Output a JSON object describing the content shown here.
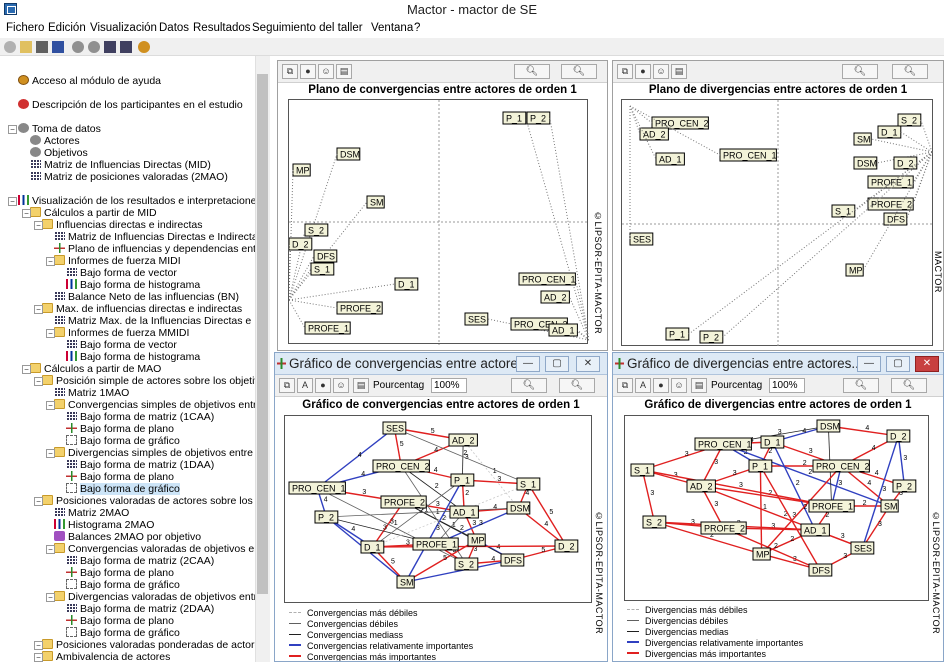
{
  "window": {
    "title": "Mactor  -  mactor de SE"
  },
  "menu": [
    "Fichero",
    "Edición",
    "Visualización",
    "Datos",
    "Resultados",
    "Seguimiento del taller",
    "Ventana",
    "?"
  ],
  "toolbar": {
    "icons": [
      "gear-icon",
      "open-icon",
      "print-icon",
      "save-icon",
      "eye-icon",
      "eye-icon",
      "grid-icon",
      "grid-icon",
      "help-icon"
    ]
  },
  "tree": {
    "items": [
      {
        "label": "Acceso al módulo de ayuda",
        "icon": "help-icon"
      },
      {
        "label": "Descripción de los participantes en el estudio",
        "icon": "people-icon"
      },
      {
        "label": "Toma de datos",
        "icon": "gear-icon"
      },
      {
        "label": "Actores",
        "icon": "gear-icon"
      },
      {
        "label": "Objetivos",
        "icon": "gear-icon"
      },
      {
        "label": "Matriz de Influencias Directas (MID)",
        "icon": "grid-icon"
      },
      {
        "label": "Matriz de posiciones valoradas (2MAO)",
        "icon": "grid-icon"
      },
      {
        "label": "Visualización de los resultados e interpretaciones",
        "icon": "chart-icon"
      },
      {
        "label": "Cálculos a partir de MID",
        "icon": "folder-icon"
      },
      {
        "label": "Influencias directas e indirectas",
        "icon": "folder-icon"
      },
      {
        "label": "Matriz de Influencias Directas e Indirectas (MI",
        "icon": "grid-icon"
      },
      {
        "label": "Plano de influencias y dependencias entre ac",
        "icon": "plane-icon"
      },
      {
        "label": "Informes de fuerza MIDI",
        "icon": "folder-icon"
      },
      {
        "label": "Bajo forma de vector",
        "icon": "grid-icon"
      },
      {
        "label": "Bajo forma de histograma",
        "icon": "histogram-icon"
      },
      {
        "label": "Balance Neto de las influencias (BN)",
        "icon": "grid-icon"
      },
      {
        "label": "Max. de influencias directas e indirectas",
        "icon": "folder-icon"
      },
      {
        "label": "Matriz Max. de la Influencias Directas e Indire",
        "icon": "grid-icon"
      },
      {
        "label": "Informes de fuerza MMIDI",
        "icon": "folder-icon"
      },
      {
        "label": "Bajo forma de vector",
        "icon": "grid-icon"
      },
      {
        "label": "Bajo forma de histograma",
        "icon": "histogram-icon"
      },
      {
        "label": "Cálculos a partir de MAO",
        "icon": "folder-icon"
      },
      {
        "label": "Posición simple de actores sobre los objetivos (",
        "icon": "folder-icon"
      },
      {
        "label": "Matriz 1MAO",
        "icon": "grid-icon"
      },
      {
        "label": "Convergencias simples de objetivos entre ac",
        "icon": "folder-icon"
      },
      {
        "label": "Bajo forma de matriz (1CAA)",
        "icon": "grid-icon"
      },
      {
        "label": "Bajo forma de plano",
        "icon": "plane-icon"
      },
      {
        "label": "Bajo forma de gráfico",
        "icon": "graph-icon"
      },
      {
        "label": "Divergencias simples de objetivos entre acto",
        "icon": "folder-icon"
      },
      {
        "label": "Bajo forma de matriz (1DAA)",
        "icon": "grid-icon"
      },
      {
        "label": "Bajo forma de plano",
        "icon": "plane-icon"
      },
      {
        "label": "Bajo forma de gráfico",
        "icon": "graph-icon"
      },
      {
        "label": "Posiciones valoradas de actores sobre los objet",
        "icon": "folder-icon"
      },
      {
        "label": "Matriz 2MAO",
        "icon": "grid-icon"
      },
      {
        "label": "Histograma 2MAO",
        "icon": "histogram-icon"
      },
      {
        "label": "Balances 2MAO por objetivo",
        "icon": "balance-icon"
      },
      {
        "label": "Convergencias valoradas de objetivos entre",
        "icon": "folder-icon"
      },
      {
        "label": "Bajo forma de matriz (2CAA)",
        "icon": "grid-icon"
      },
      {
        "label": "Bajo forma de plano",
        "icon": "plane-icon"
      },
      {
        "label": "Bajo forma de gráfico",
        "icon": "graph-icon"
      },
      {
        "label": "Divergencias valoradas de objetivos entre a",
        "icon": "folder-icon"
      },
      {
        "label": "Bajo forma de matriz (2DAA)",
        "icon": "grid-icon"
      },
      {
        "label": "Bajo forma de plano",
        "icon": "plane-icon"
      },
      {
        "label": "Bajo forma de gráfico",
        "icon": "graph-icon"
      },
      {
        "label": "Posiciones valoradas ponderadas de actores sc",
        "icon": "folder-icon"
      },
      {
        "label": "Ambivalencia de actores",
        "icon": "folder-icon"
      }
    ]
  },
  "panes": {
    "conv_plane": {
      "title": "Plano de convergencias entre actores de orden 1",
      "caption": "©LIPSOR-EPITA-MACTOR"
    },
    "div_plane": {
      "title": "Plano de divergencias entre actores de orden 1",
      "caption": "©LIPSOR-EPITA-MACTOR"
    },
    "conv_graph": {
      "window_title": "Gráfico de convergencias entre actores...",
      "title": "Gráfico de convergencias entre actores de orden 1",
      "caption": "©LIPSOR-EPITA-MACTOR",
      "pct_label": "Pourcentag",
      "zoom": "100%"
    },
    "div_graph": {
      "window_title": "Gráfico de divergencias entre actores...",
      "title": "Gráfico de divergencias entre actores de orden 1",
      "caption": "©LIPSOR-EPITA-MACTOR",
      "pct_label": "Pourcentag",
      "zoom": "100%"
    }
  },
  "legends": {
    "conv": [
      "Convergencias más débiles",
      "Convergencias débiles",
      "Convergencias mediass",
      "Convergencias relativamente importantes",
      "Convergencias más importantes"
    ],
    "div": [
      "Divergencias más débiles",
      "Divergencias débiles",
      "Divergencias medias",
      "Divergencias relativamente importantes",
      "Divergencias más importantes"
    ]
  },
  "chart_data": [
    {
      "type": "scatter",
      "title": "Plano de convergencias entre actores de orden 1",
      "points": [
        {
          "label": "P_1"
        },
        {
          "label": "P_2"
        },
        {
          "label": "DSM"
        },
        {
          "label": "MP"
        },
        {
          "label": "SM"
        },
        {
          "label": "S_2"
        },
        {
          "label": "D_2"
        },
        {
          "label": "DFS"
        },
        {
          "label": "S_1"
        },
        {
          "label": "D_1"
        },
        {
          "label": "PROFE_2"
        },
        {
          "label": "PROFE_1"
        },
        {
          "label": "PRO_CEN_1"
        },
        {
          "label": "AD_2"
        },
        {
          "label": "SES"
        },
        {
          "label": "PRO_CEN_2"
        },
        {
          "label": "AD_1"
        }
      ]
    },
    {
      "type": "scatter",
      "title": "Plano de divergencias entre actores de orden 1",
      "points": [
        {
          "label": "S_2"
        },
        {
          "label": "PRO_CEN_2"
        },
        {
          "label": "D_1"
        },
        {
          "label": "AD_2"
        },
        {
          "label": "SM"
        },
        {
          "label": "PRO_CEN_1"
        },
        {
          "label": "AD_1"
        },
        {
          "label": "DSM"
        },
        {
          "label": "D_2"
        },
        {
          "label": "PROFE_1"
        },
        {
          "label": "PROFE_2"
        },
        {
          "label": "S_1"
        },
        {
          "label": "DFS"
        },
        {
          "label": "SES"
        },
        {
          "label": "MP"
        },
        {
          "label": "P_1"
        },
        {
          "label": "P_2"
        }
      ]
    },
    {
      "type": "network",
      "title": "Gráfico de convergencias entre actores de orden 1",
      "nodes": [
        "SES",
        "AD_2",
        "PRO_CEN_2",
        "PRO_CEN_1",
        "P_1",
        "S_1",
        "PROFE_2",
        "P_2",
        "AD_1",
        "DSM",
        "MP",
        "D_2",
        "D_1",
        "PROFE_1",
        "S_2",
        "DFS",
        "SM"
      ],
      "edge_labels": [
        "5",
        "4",
        "3",
        "2",
        "1"
      ]
    },
    {
      "type": "network",
      "title": "Gráfico de divergencias entre actores de orden 1",
      "nodes": [
        "DSM",
        "D_2",
        "PRO_CEN_1",
        "D_1",
        "P_1",
        "PRO_CEN_2",
        "S_1",
        "AD_2",
        "P_2",
        "PROFE_1",
        "SM",
        "S_2",
        "PROFE_2",
        "AD_1",
        "SES",
        "MP",
        "DFS"
      ],
      "edge_labels": [
        "4",
        "3",
        "2",
        "1"
      ]
    }
  ],
  "colors": {
    "weak": "#b0b0b0",
    "medium": "#404040",
    "relative": "#3040c0",
    "strong": "#e02020",
    "selection": "#cce4f7"
  }
}
